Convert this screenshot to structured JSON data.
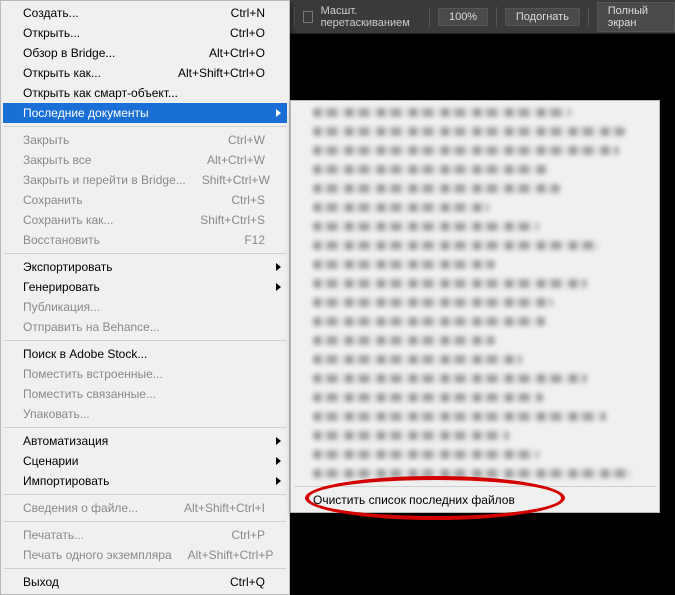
{
  "toolbar": {
    "drag_scale_label": "Масшт. перетаскиванием",
    "zoom_value": "100%",
    "fit_label": "Подогнать",
    "fullscreen_label": "Полный экран"
  },
  "menu": {
    "items": [
      {
        "label": "Создать...",
        "shortcut": "Ctrl+N",
        "disabled": false
      },
      {
        "label": "Открыть...",
        "shortcut": "Ctrl+O",
        "disabled": false
      },
      {
        "label": "Обзор в Bridge...",
        "shortcut": "Alt+Ctrl+O",
        "disabled": false
      },
      {
        "label": "Открыть как...",
        "shortcut": "Alt+Shift+Ctrl+O",
        "disabled": false
      },
      {
        "label": "Открыть как смарт-объект...",
        "shortcut": "",
        "disabled": false
      },
      {
        "label": "Последние документы",
        "shortcut": "",
        "disabled": false,
        "submenu": true,
        "highlight": true
      },
      {
        "sep": true
      },
      {
        "label": "Закрыть",
        "shortcut": "Ctrl+W",
        "disabled": true
      },
      {
        "label": "Закрыть все",
        "shortcut": "Alt+Ctrl+W",
        "disabled": true
      },
      {
        "label": "Закрыть и перейти в Bridge...",
        "shortcut": "Shift+Ctrl+W",
        "disabled": true
      },
      {
        "label": "Сохранить",
        "shortcut": "Ctrl+S",
        "disabled": true
      },
      {
        "label": "Сохранить как...",
        "shortcut": "Shift+Ctrl+S",
        "disabled": true
      },
      {
        "label": "Восстановить",
        "shortcut": "F12",
        "disabled": true
      },
      {
        "sep": true
      },
      {
        "label": "Экспортировать",
        "shortcut": "",
        "disabled": false,
        "submenu": true
      },
      {
        "label": "Генерировать",
        "shortcut": "",
        "disabled": false,
        "submenu": true
      },
      {
        "label": "Публикация...",
        "shortcut": "",
        "disabled": true
      },
      {
        "label": "Отправить на Behance...",
        "shortcut": "",
        "disabled": true
      },
      {
        "sep": true
      },
      {
        "label": "Поиск в Adobe Stock...",
        "shortcut": "",
        "disabled": false
      },
      {
        "label": "Поместить встроенные...",
        "shortcut": "",
        "disabled": true
      },
      {
        "label": "Поместить связанные...",
        "shortcut": "",
        "disabled": true
      },
      {
        "label": "Упаковать...",
        "shortcut": "",
        "disabled": true
      },
      {
        "sep": true
      },
      {
        "label": "Автоматизация",
        "shortcut": "",
        "disabled": false,
        "submenu": true
      },
      {
        "label": "Сценарии",
        "shortcut": "",
        "disabled": false,
        "submenu": true
      },
      {
        "label": "Импортировать",
        "shortcut": "",
        "disabled": false,
        "submenu": true
      },
      {
        "sep": true
      },
      {
        "label": "Сведения о файле...",
        "shortcut": "Alt+Shift+Ctrl+I",
        "disabled": true
      },
      {
        "sep": true
      },
      {
        "label": "Печатать...",
        "shortcut": "Ctrl+P",
        "disabled": true
      },
      {
        "label": "Печать одного экземпляра",
        "shortcut": "Alt+Shift+Ctrl+P",
        "disabled": true
      },
      {
        "sep": true
      },
      {
        "label": "Выход",
        "shortcut": "Ctrl+Q",
        "disabled": false
      }
    ]
  },
  "submenu": {
    "recent_count": 20,
    "clear_label": "Очистить список последних файлов"
  }
}
